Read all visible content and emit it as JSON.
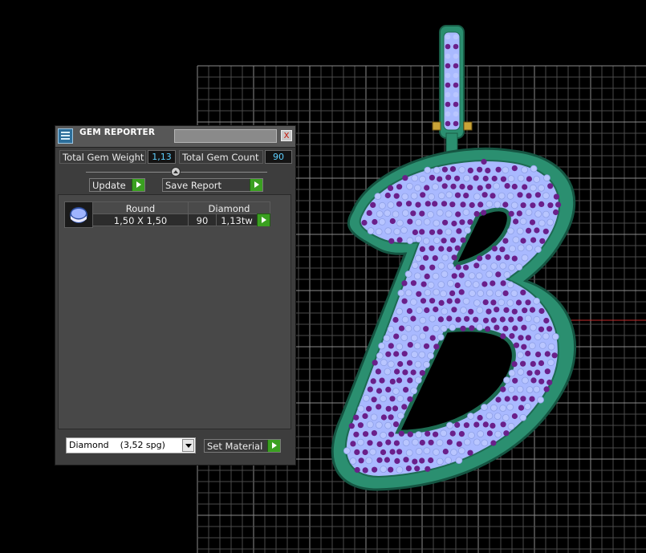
{
  "panel": {
    "title": "GEM REPORTER",
    "close_glyph": "x",
    "total_weight_label": "Total Gem Weight",
    "total_weight_value": "1,13",
    "total_count_label": "Total Gem Count",
    "total_count_value": "90",
    "update_label": "Update",
    "save_report_label": "Save Report",
    "gem_row": {
      "shape": "Round",
      "material": "Diamond",
      "size": "1,50 X 1,50",
      "count": "90",
      "weight": "1,13tw"
    },
    "material_select_value": "Diamond    (3,52 spg)",
    "set_material_label": "Set Material"
  },
  "icons": {
    "title_icon": "gem-reporter-icon",
    "close": "close-icon",
    "go": "play-arrow-icon",
    "thumb": "round-gem-icon",
    "dropdown": "chevron-down-icon"
  },
  "colors": {
    "pendant_metal": "#2b8f70",
    "pendant_metal_dark": "#1d6b52",
    "stone_base": "#a9b9ff",
    "gem_prong": "#6a1f8a",
    "grid_line": "#5e5e5e",
    "axis": "#c22b2b",
    "value_text": "#5ed0ff",
    "go_button": "#3aa020"
  }
}
